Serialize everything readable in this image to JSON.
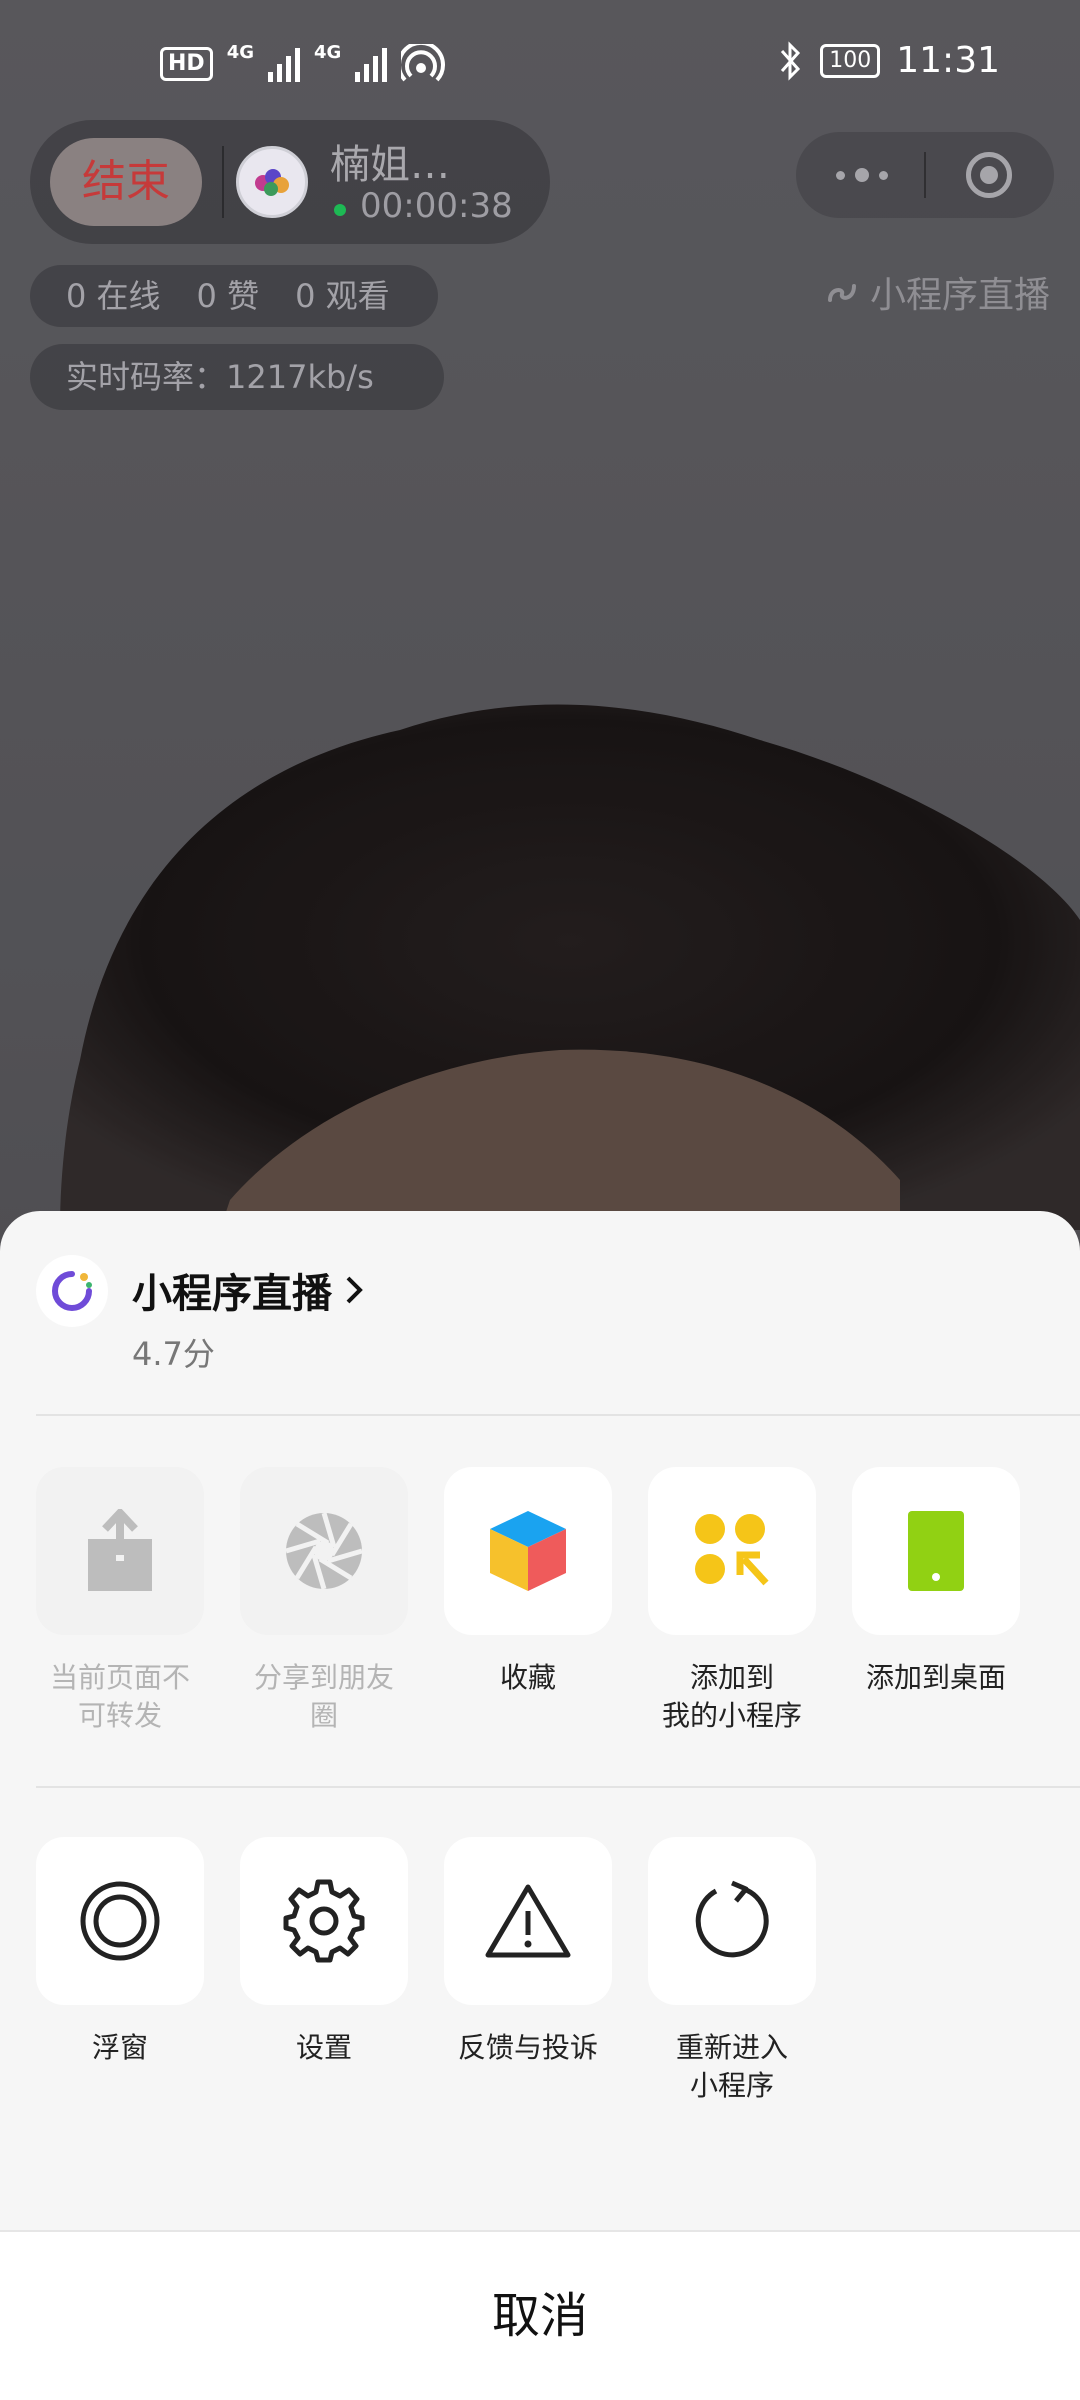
{
  "status_bar": {
    "hd": "HD",
    "sim": "1",
    "net1": "4G",
    "net2": "4G",
    "hotspot": "1",
    "battery": "100",
    "time": "11:31"
  },
  "live": {
    "end_label": "结束",
    "host_name": "楠姐…",
    "timer": "00:00:38",
    "stats": {
      "online": "0 在线",
      "likes": "0 赞",
      "views": "0 观看"
    },
    "bitrate": "实时码率：1217kb/s",
    "mini_program_tag": "小程序直播"
  },
  "sheet": {
    "app_title": "小程序直播",
    "rating": "4.7分",
    "row1": [
      {
        "label": "当前页面不\n可转发",
        "icon": "share-icon",
        "disabled": true
      },
      {
        "label": "分享到朋友\n圈",
        "icon": "moments-icon",
        "disabled": true
      },
      {
        "label": "收藏",
        "icon": "favorite-cube-icon",
        "disabled": false
      },
      {
        "label": "添加到\n我的小程序",
        "icon": "add-to-my-miniprogram-icon",
        "disabled": false
      },
      {
        "label": "添加到桌面",
        "icon": "add-to-desktop-icon",
        "disabled": false
      }
    ],
    "row2": [
      {
        "label": "浮窗",
        "icon": "floating-window-icon"
      },
      {
        "label": "设置",
        "icon": "settings-gear-icon"
      },
      {
        "label": "反馈与投诉",
        "icon": "warning-triangle-icon"
      },
      {
        "label": "重新进入\n小程序",
        "icon": "reload-icon"
      }
    ],
    "cancel_label": "取消"
  },
  "colors": {
    "end_red": "#c63a3a",
    "green_dot": "#1db954",
    "favorite_blue": "#1aa3f0",
    "favorite_yellow": "#f6c12c",
    "favorite_red": "#ef5b5b",
    "my_mp_yellow": "#f5c518",
    "desktop_green": "#91d113"
  }
}
